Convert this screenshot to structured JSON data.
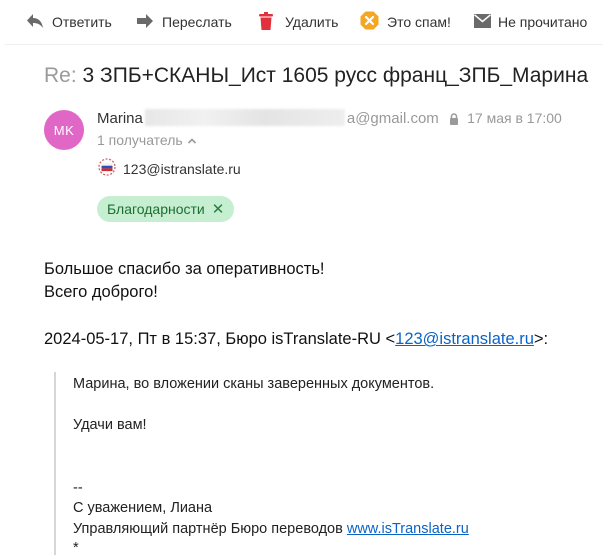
{
  "toolbar": {
    "reply_label": "Ответить",
    "forward_label": "Переслать",
    "delete_label": "Удалить",
    "spam_label": "Это спам!",
    "unread_label": "Не прочитано"
  },
  "message": {
    "subject_prefix": "Re:",
    "subject": "3 ЗПБ+СКАНЫ_Ист 1605 русс франц_ЗПБ_Марина",
    "avatar_initials": "MK",
    "sender_name": "Marina",
    "sender_email_tail": "a@gmail.com",
    "date": "17 мая в 17:00",
    "recipients_count": "1 получатель",
    "recipient_email": "123@istranslate.ru",
    "label": "Благодарности",
    "body": [
      "Большое спасибо за оперативность!",
      "Всего доброго!"
    ],
    "quote_header_prefix": "2024-05-17, Пт в 15:37, Бюро isTranslate-RU <",
    "quote_header_email": "123@istranslate.ru",
    "quote_header_suffix": ">:",
    "quote": {
      "line1": "Марина, во вложении сканы заверенных документов.",
      "line2": "Удачи вам!",
      "dashes": "--",
      "regards": "С уважением, Лиана",
      "position_prefix": "Управляющий партнёр Бюро переводов ",
      "site": "www.isTranslate.ru",
      "star": "*"
    }
  },
  "colors": {
    "avatar": "#e067c6",
    "label_bg": "#c5efd0",
    "link": "#0b63c7",
    "delete_icon": "#e0313c",
    "spam_icon": "#f5a623"
  }
}
